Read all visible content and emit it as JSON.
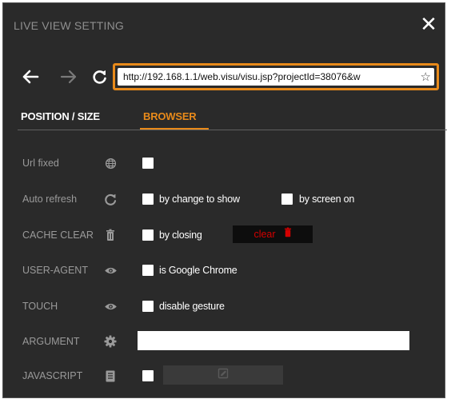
{
  "window": {
    "title": "LIVE VIEW SETTING",
    "close_icon": "close-icon"
  },
  "navigation": {
    "back_icon": "arrow-left-icon",
    "forward_icon": "arrow-right-icon",
    "refresh_icon": "refresh-icon",
    "url": "http://192.168.1.1/web.visu/visu.jsp?projectId=38076&w",
    "bookmark_icon": "star-icon",
    "url_border_color": "#e88a1a"
  },
  "tabs": [
    {
      "label": "POSITION / SIZE",
      "active": false
    },
    {
      "label": "BROWSER",
      "active": true
    }
  ],
  "colors": {
    "accent": "#e88a1a",
    "background": "#2a2a2a",
    "clear_text": "#d40000"
  },
  "settings": {
    "url_fixed": {
      "label": "Url fixed",
      "icon": "globe-icon",
      "checked": false
    },
    "auto_refresh": {
      "label": "Auto refresh",
      "icon": "refresh-icon",
      "option1": "by change to show",
      "option2": "by screen on"
    },
    "cache_clear": {
      "label": "CACHE CLEAR",
      "icon": "trash-icon",
      "option": "by closing",
      "button": "clear",
      "button_icon": "trash-icon"
    },
    "user_agent": {
      "label": "USER-AGENT",
      "icon": "eye-icon",
      "option": "is Google Chrome"
    },
    "touch": {
      "label": "TOUCH",
      "icon": "eye-icon",
      "option": "disable gesture"
    },
    "argument": {
      "label": "ARGUMENT",
      "icon": "gear-icon",
      "value": ""
    },
    "javascript": {
      "label": "JAVASCRIPT",
      "icon": "document-icon",
      "button_icon": "edit-icon"
    }
  }
}
